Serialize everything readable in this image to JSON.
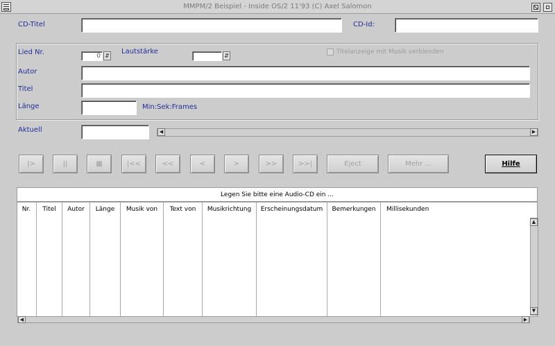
{
  "window": {
    "title": "MMPM/2 Beispiel - Inside OS/2 11'93 (C) Axel Salomon"
  },
  "cd": {
    "title_label": "CD-Titel",
    "title_value": "",
    "id_label": "CD-Id:",
    "id_value": ""
  },
  "song": {
    "nr_label": "Lied Nr.",
    "nr_value": "0",
    "volume_label": "Lautstärke",
    "volume_value": "",
    "fade_label": "Titelanzeige mit Musik verblenden",
    "author_label": "Autor",
    "author_value": "",
    "title_label": "Titel",
    "title_value": "",
    "length_label": "Länge",
    "length_value": "",
    "length_unit": "Min:Sek:Frames"
  },
  "current": {
    "label": "Aktuell",
    "value": ""
  },
  "buttons": {
    "play": "|>",
    "pause": "||",
    "stop": "▦",
    "first": "|<<",
    "rewind": "<<",
    "prev": "<",
    "next": ">",
    "forward": ">>",
    "last": ">>|",
    "eject": "Eject",
    "more": "Mehr ...",
    "help": "Hilfe"
  },
  "list": {
    "status": "Legen Sie bitte eine Audio-CD ein ...",
    "columns": [
      "Nr.",
      "Titel",
      "Autor",
      "Länge",
      "Musik von",
      "Text von",
      "Musikrichtung",
      "Erscheinungsdatum",
      "Bemerkungen",
      "Millisekunden"
    ]
  },
  "icons": {
    "system_menu": "system-menu-icon",
    "maximize": "maximize-icon",
    "restore": "restore-icon",
    "spin": "spin-arrows-icon",
    "scroll_left": "arrow-left-icon",
    "scroll_right": "arrow-right-icon",
    "scroll_up": "arrow-up-icon",
    "scroll_down": "arrow-down-icon"
  }
}
